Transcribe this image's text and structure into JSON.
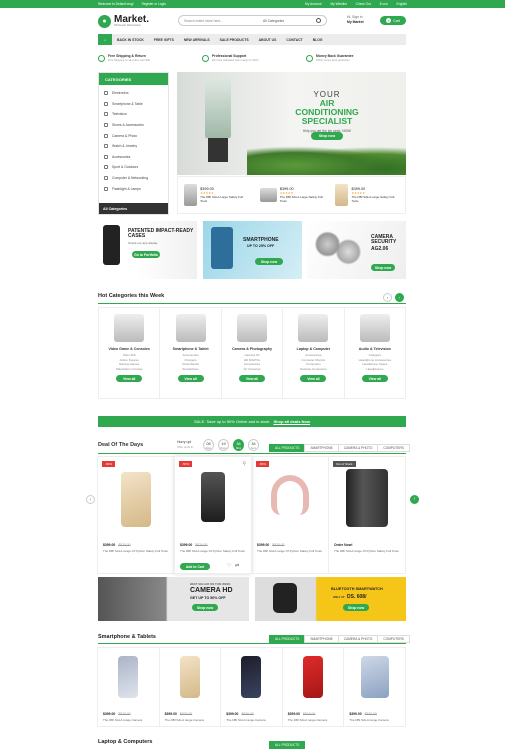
{
  "topbar": {
    "left1": "Welcome to Default msg!",
    "left2": "Register or Login",
    "my_account": "My Account",
    "my_wishlist": "My Wishlist",
    "checkout": "Check Out",
    "currency": "$ usd",
    "language": "English"
  },
  "header": {
    "logo_name": "Market.",
    "logo_tag": "Wholesale Marketplace",
    "search_placeholder": "Search entire store here...",
    "search_category": "All Categories",
    "hi": "Hi, Sign in",
    "my_market": "My Market",
    "cart_label": "Cart",
    "cart_count": "0"
  },
  "nav": [
    "BACK IN STOCK",
    "FREE GIFTS",
    "NEW ARRIVALS",
    "SALE PRODUCTS",
    "ABOUT US",
    "CONTACT",
    "BLOG"
  ],
  "features": [
    {
      "title": "Free Shipping & Return",
      "sub": "Free Shipping on all orders over $99"
    },
    {
      "title": "Professional Support",
      "sub": "We have dedicated team ready for 24h/7"
    },
    {
      "title": "Money Back Guarantee",
      "sub": "100% money back guarantee"
    }
  ],
  "sidebar": {
    "title": "CATEGORIES",
    "items": [
      "Electronics",
      "Smartphone & Table",
      "Television",
      "Shoes & Accessories",
      "Camera & Photo",
      "Watch & Jewelry",
      "Accessories",
      "Sport & Outdoors",
      "Computer & Networking",
      "Flashlight & Lamps"
    ],
    "all": "All Categories"
  },
  "hero": {
    "line1": "YOUR",
    "line2": "AIR CONDITIONING",
    "line3": "SPECIALIST",
    "sub": "Help you get the Ice need. NOW!",
    "button": "Shop now"
  },
  "hero_products": [
    {
      "price": "$399.00",
      "name": "The DBI SALA Large Safety Full Tools"
    },
    {
      "price": "$399.00",
      "name": "The DBI SALA Large Safety Full Tools"
    },
    {
      "price": "$399.00",
      "name": "The DBI SALA Large Safety Full Tools"
    }
  ],
  "banners": {
    "b1_title": "PATENTED IMPACT-READY CASES",
    "b1_sub": "Check our app display",
    "b1_btn": "Go to Portfolio",
    "b2_title": "SMARTPHONE",
    "b2_sub": "UP TO 25% OFF",
    "b2_btn": "Shop now",
    "b3_title": "CAMERA SECURITY",
    "b3_sub": "AG2.06",
    "b3_btn": "Shop now"
  },
  "hot": {
    "title": "Hot Categories this Week",
    "items": [
      {
        "name": "Video Game & Consoles",
        "subs": [
          "Xbox 360",
          "Action Figures",
          "Racing Games",
          "Playstation Console"
        ],
        "btn": "View all"
      },
      {
        "name": "Smartphone & Tablet",
        "subs": [
          "Accessories",
          "Chargers",
          "Powerbanks",
          "Smartphone"
        ],
        "btn": "View all"
      },
      {
        "name": "Camera & Photography",
        "subs": [
          "Camera Kit",
          "HD DIGITAL",
          "Accessories",
          "Air Cameras"
        ],
        "btn": "View all"
      },
      {
        "name": "Laptop & Computer",
        "subs": [
          "Accessories",
          "Computer Monitor",
          "Computers",
          "Desktop Computers"
        ],
        "btn": "View all"
      },
      {
        "name": "Audio & Television",
        "subs": [
          "Chargers",
          "Headphone Accessories",
          "Headphone Cases",
          "Headphones"
        ],
        "btn": "View all"
      }
    ]
  },
  "promo": {
    "text": "SALE. Save up to 50% Online and in store.",
    "link": "Shop all deals Now"
  },
  "deal": {
    "title": "Deal Of The Days",
    "hurry": "Hurry up!",
    "hurry_sub": "Offer ends In:",
    "counts": [
      {
        "v": "06",
        "l": "Days"
      },
      {
        "v": "19",
        "l": "Hours"
      },
      {
        "v": "36",
        "l": "Mins"
      },
      {
        "v": "34",
        "l": "Secs"
      }
    ],
    "tabs": [
      "ALL PRODUCTS",
      "SMARTPHONE",
      "CAMERA & PHOTO",
      "COMPUTERS"
    ],
    "products": [
      {
        "tag": "-50%",
        "price": "$399.00",
        "old": "$520.00",
        "name": "The DBI SALA range Of Python Safety Full Tools"
      },
      {
        "tag": "-50%",
        "price": "$399.00",
        "old": "$520.00",
        "name": "The DBI SALA range Of Python Safety Full Tools",
        "btn": "Add to Cart"
      },
      {
        "tag": "-50%",
        "price": "$399.00",
        "old": "$520.00",
        "name": "The DBI SALA range Of Python Safety Full Tools"
      },
      {
        "tag": "Out of Stock",
        "price": "Order Now!",
        "old": "",
        "name": "The DBI SALA range Of Python Safety Full Tools"
      }
    ]
  },
  "promo_banners": {
    "p1_small": "BEST SELLER ON THIS WEEK",
    "p1_title": "CAMERA HD",
    "p1_sub": "GET UP TO 50% OFF",
    "p1_btn": "Shop now",
    "p2_title": "BLUETOOTH SMARTWATCH",
    "p2_only": "ONLY AT",
    "p2_price": "DS. 608/",
    "p2_btn": "Shop now"
  },
  "smart": {
    "title": "Smartphone & Tablets",
    "tabs": [
      "ALL PRODUCTS",
      "SMARTPHONE",
      "CAMERA & PHOTO",
      "COMPUTERS"
    ],
    "products": [
      {
        "price": "$399.00",
        "old": "$520.00",
        "name": "The DBI SALA range Camera"
      },
      {
        "price": "$399.00",
        "old": "$520.00",
        "name": "The DBI SALA range Camera"
      },
      {
        "price": "$399.00",
        "old": "$520.00",
        "name": "The DBI SALA range Camera"
      },
      {
        "price": "$399.00",
        "old": "$520.00",
        "name": "The DBI SALA range Camera"
      },
      {
        "price": "$399.00",
        "old": "$520.00",
        "name": "The DBI SALA range Camera"
      }
    ]
  },
  "laptop": {
    "title": "Laptop & Computers",
    "tab": "ALL PRODUCTS"
  },
  "colors": {
    "accent": "#2fa84f",
    "sale": "#e53935",
    "dark": "#333333"
  }
}
